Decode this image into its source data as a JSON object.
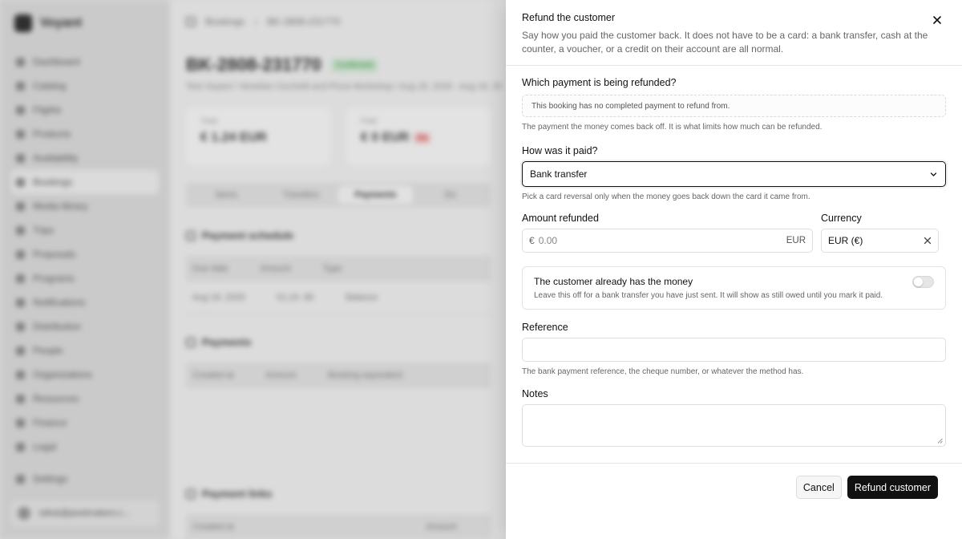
{
  "background": {
    "brand": "Voyant",
    "nav": [
      "Dashboard",
      "Catalog",
      "Flights",
      "Products",
      "Availability",
      "Bookings",
      "Media library",
      "Trips",
      "Proposals",
      "Programs",
      "Notifications",
      "Distribution",
      "People",
      "Organizations",
      "Resources",
      "Finance",
      "Legal"
    ],
    "nav_active": "Bookings",
    "settings": "Settings",
    "user_email": "rafiuk@pixelmakers.c...",
    "breadcrumb": [
      "Bookings",
      "BK-2808-231770"
    ],
    "booking_id": "BK-2808-231770",
    "status": "Confirmed",
    "subtitle": "Test Voyant  /  Venetian Cicchetti and Pizza Workshop  /  Aug 18, 2026 - Aug 18, 20",
    "stats": [
      {
        "label": "Total",
        "value": "€ 1.24 EUR",
        "chip": ""
      },
      {
        "label": "Paid",
        "value": "€ 0 EUR",
        "chip": "0%"
      }
    ],
    "tabs": [
      "Items",
      "Travelers",
      "Payments",
      "Do"
    ],
    "schedule_title": "Payment schedule",
    "schedule_headers": [
      "Due date",
      "Amount",
      "Type"
    ],
    "schedule_row": [
      "Aug 18, 2026",
      "€1.24 .86",
      "Balance"
    ],
    "payments_title": "Payments",
    "payments_headers": [
      "Created at",
      "Amount",
      "Booking equivalent"
    ],
    "links_title": "Payment links",
    "links_headers": [
      "Created at",
      "Amount"
    ]
  },
  "dialog": {
    "title": "Refund the customer",
    "description": "Say how you paid the customer back. It does not have to be a card: a bank transfer, cash at the counter, a voucher, or a credit on their account are all normal.",
    "payment_label": "Which payment is being refunded?",
    "payment_notice": "This booking has no completed payment to refund from.",
    "payment_help": "The payment the money comes back off. It is what limits how much can be refunded.",
    "method_label": "How was it paid?",
    "method_value": "Bank transfer",
    "method_help": "Pick a card reversal only when the money goes back down the card it came from.",
    "amount_label": "Amount refunded",
    "amount_prefix": "€",
    "amount_placeholder": "0.00",
    "amount_suffix": "EUR",
    "currency_label": "Currency",
    "currency_value": "EUR (€)",
    "received_title": "The customer already has the money",
    "received_desc": "Leave this off for a bank transfer you have just sent. It will show as still owed until you mark it paid.",
    "received_on": false,
    "reference_label": "Reference",
    "reference_help": "The bank payment reference, the cheque number, or whatever the method has.",
    "notes_label": "Notes",
    "cancel_label": "Cancel",
    "submit_label": "Refund customer"
  }
}
